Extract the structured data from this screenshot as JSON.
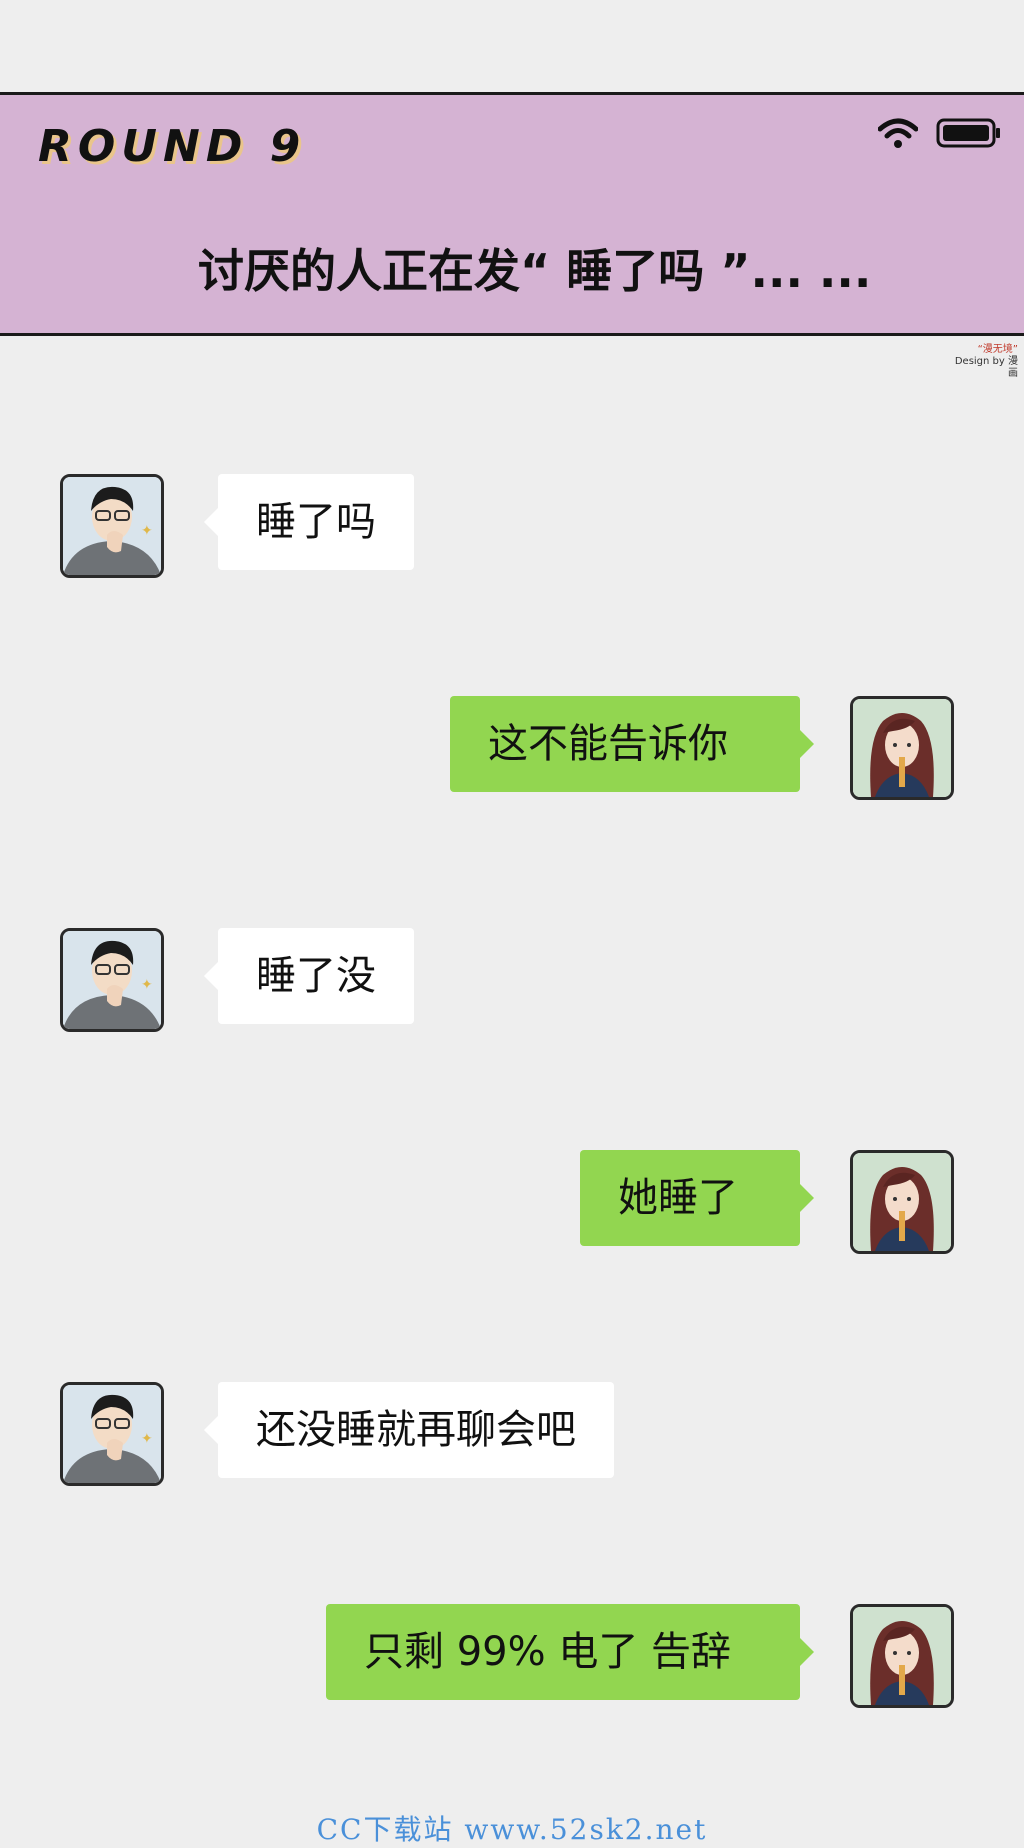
{
  "header": {
    "round_label": "ROUND 9",
    "title": "讨厌的人正在发“ 睡了吗 ”...   ...",
    "wifi_icon": "wifi-icon",
    "battery_icon": "battery-icon"
  },
  "watermark": {
    "line1": "“漫无境”",
    "line2": "Design by 漫画"
  },
  "messages": [
    {
      "sender": "male",
      "side": "left",
      "text": "睡了吗"
    },
    {
      "sender": "female",
      "side": "right",
      "text": "这不能告诉你"
    },
    {
      "sender": "male",
      "side": "left",
      "text": "睡了没"
    },
    {
      "sender": "female",
      "side": "right",
      "text": "她睡了"
    },
    {
      "sender": "male",
      "side": "left",
      "text": "还没睡就再聊会吧"
    },
    {
      "sender": "female",
      "side": "right",
      "text": "只剩 99% 电了  告辞"
    }
  ],
  "colors": {
    "header_bg": "#d5b3d3",
    "page_bg": "#eeeeee",
    "bubble_green": "#92d650",
    "bubble_white": "#ffffff"
  },
  "footer": {
    "site_text": "CC下载站 www.52sk2.net"
  }
}
